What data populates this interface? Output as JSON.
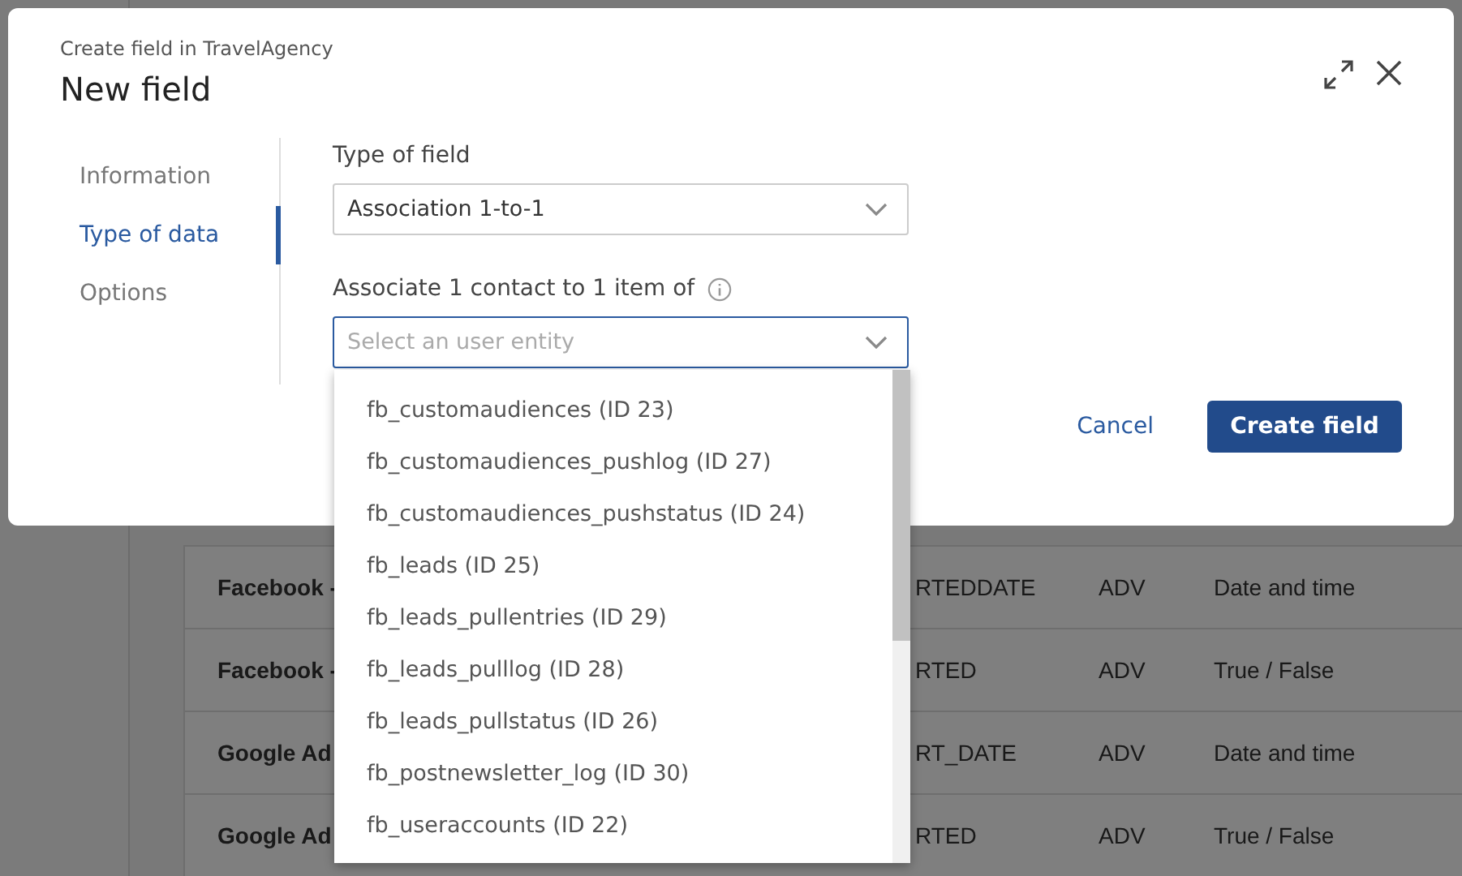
{
  "background_page": {
    "table": {
      "rows": [
        {
          "column_1": "Facebook -",
          "column_2": "RTEDDATE",
          "column_3": "ADV",
          "column_4": "Date and time"
        },
        {
          "column_1": "Facebook -",
          "column_2": "RTED",
          "column_3": "ADV",
          "column_4": "True / False"
        },
        {
          "column_1": "Google Ad",
          "column_2": "RT_DATE",
          "column_3": "ADV",
          "column_4": "Date and time"
        },
        {
          "column_1": "Google Ad",
          "column_2": "RTED",
          "column_3": "ADV",
          "column_4": "True / False"
        }
      ]
    }
  },
  "dialog": {
    "subtitle": "Create field in TravelAgency",
    "title": "New field",
    "steps": [
      {
        "label": "Information",
        "selected": false
      },
      {
        "label": "Type of data",
        "selected": true
      },
      {
        "label": "Options",
        "selected": false
      }
    ],
    "type_field": {
      "label": "Type of field",
      "value": "Association 1-to-1"
    },
    "entity_field": {
      "label": "Associate 1 contact to 1 item of",
      "placeholder": "Select an user entity",
      "expanded": true,
      "options": [
        {
          "label": "fb_customaudiences (ID 23)",
          "selected": false
        },
        {
          "label": "fb_customaudiences_pushlog (ID 27)",
          "selected": false
        },
        {
          "label": "fb_customaudiences_pushstatus (ID 24)",
          "selected": false
        },
        {
          "label": "fb_leads (ID 25)",
          "selected": false
        },
        {
          "label": "fb_leads_pullentries (ID 29)",
          "selected": false
        },
        {
          "label": "fb_leads_pulllog (ID 28)",
          "selected": false
        },
        {
          "label": "fb_leads_pullstatus (ID 26)",
          "selected": false
        },
        {
          "label": "fb_postnewsletter_log (ID 30)",
          "selected": false
        },
        {
          "label": "fb_useraccounts (ID 22)",
          "selected": false
        }
      ]
    },
    "buttons": {
      "cancel": "Cancel",
      "create": "Create field"
    }
  }
}
